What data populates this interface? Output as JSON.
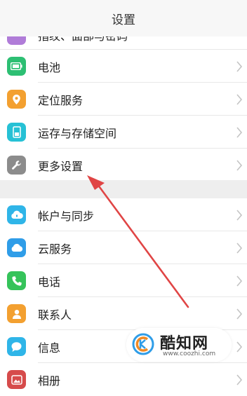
{
  "header": {
    "title": "设置"
  },
  "partial_item": {
    "label": "指纹、面部与密码"
  },
  "group1": [
    {
      "label": "电池",
      "icon": "battery-icon",
      "color": "#2dbf73"
    },
    {
      "label": "定位服务",
      "icon": "location-pin-icon",
      "color": "#f3a030"
    },
    {
      "label": "运存与存储空间",
      "icon": "storage-icon",
      "color": "#26c1d5"
    },
    {
      "label": "更多设置",
      "icon": "wrench-icon",
      "color": "#8c8c8c"
    }
  ],
  "group2": [
    {
      "label": "帐户与同步",
      "icon": "account-sync-icon",
      "color": "#2fb5e8"
    },
    {
      "label": "云服务",
      "icon": "cloud-icon",
      "color": "#2f9de8"
    },
    {
      "label": "电话",
      "icon": "phone-icon",
      "color": "#35c35a"
    },
    {
      "label": "联系人",
      "icon": "contacts-icon",
      "color": "#f3a030"
    },
    {
      "label": "信息",
      "icon": "message-icon",
      "color": "#2fb5e8"
    },
    {
      "label": "相册",
      "icon": "album-icon",
      "color": "#d64b4b"
    }
  ],
  "watermark": {
    "brand": "酷知网",
    "url": "www.coozhi.com"
  },
  "annotation": {
    "arrow_color": "#e04545"
  }
}
